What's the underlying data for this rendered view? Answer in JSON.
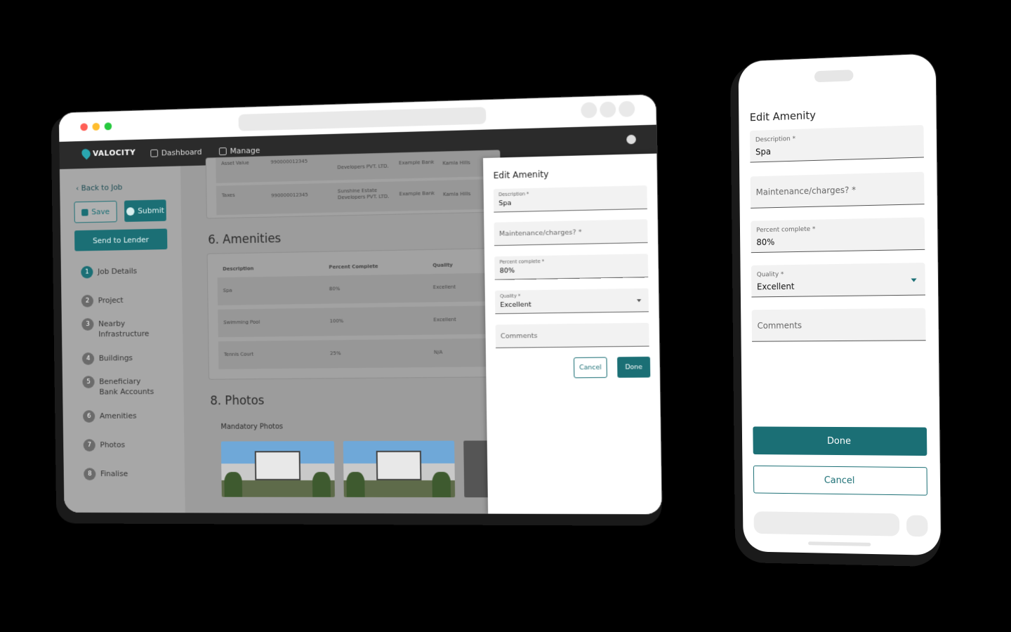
{
  "desktop": {
    "brand": "VALOCITY",
    "nav": {
      "dashboard": "Dashboard",
      "manage": "Manage"
    },
    "sidebar": {
      "back": "Back to Job",
      "save": "Save",
      "submit": "Submit",
      "send": "Send to Lender",
      "steps": [
        {
          "num": "1",
          "label": "Job Details"
        },
        {
          "num": "2",
          "label": "Project"
        },
        {
          "num": "3",
          "label": "Nearby Infrastructure"
        },
        {
          "num": "4",
          "label": "Buildings"
        },
        {
          "num": "5",
          "label": "Beneficiary Bank Accounts"
        },
        {
          "num": "6",
          "label": "Amenities"
        },
        {
          "num": "7",
          "label": "Photos"
        },
        {
          "num": "8",
          "label": "Finalise"
        }
      ]
    },
    "top_table": {
      "rows": [
        {
          "type": "Asset Value",
          "number": "990000012345",
          "developer": "Developers PVT. LTD.",
          "bank": "Example Bank",
          "location": "Kamla Hills"
        },
        {
          "type": "Taxes",
          "number": "990000012345",
          "developer": "Sunshine Estate Developers PVT. LTD.",
          "bank": "Example Bank",
          "location": "Kamla Hills"
        }
      ]
    },
    "amenities": {
      "heading": "6. Amenities",
      "columns": [
        "Description",
        "Percent Complete",
        "Quality"
      ],
      "rows": [
        [
          "Spa",
          "80%",
          "Excellent"
        ],
        [
          "Swimming Pool",
          "100%",
          "Excellent"
        ],
        [
          "Tennis Court",
          "25%",
          "N/A"
        ]
      ]
    },
    "photos": {
      "heading": "8. Photos",
      "subheading": "Mandatory Photos"
    },
    "panel": {
      "title": "Edit Amenity",
      "description_label": "Description *",
      "description_value": "Spa",
      "maintenance_placeholder": "Maintenance/charges? *",
      "percent_label": "Percent complete *",
      "percent_value": "80%",
      "quality_label": "Quality *",
      "quality_value": "Excellent",
      "comments_placeholder": "Comments",
      "cancel": "Cancel",
      "done": "Done"
    }
  },
  "phone": {
    "title": "Edit Amenity",
    "description_label": "Description *",
    "description_value": "Spa",
    "maintenance_placeholder": "Maintenance/charges? *",
    "percent_label": "Percent complete *",
    "percent_value": "80%",
    "quality_label": "Quality *",
    "quality_value": "Excellent",
    "comments_placeholder": "Comments",
    "done": "Done",
    "cancel": "Cancel"
  },
  "colors": {
    "accent": "#1b6f75",
    "navbar": "#2b2b2b",
    "background": "#000000"
  }
}
